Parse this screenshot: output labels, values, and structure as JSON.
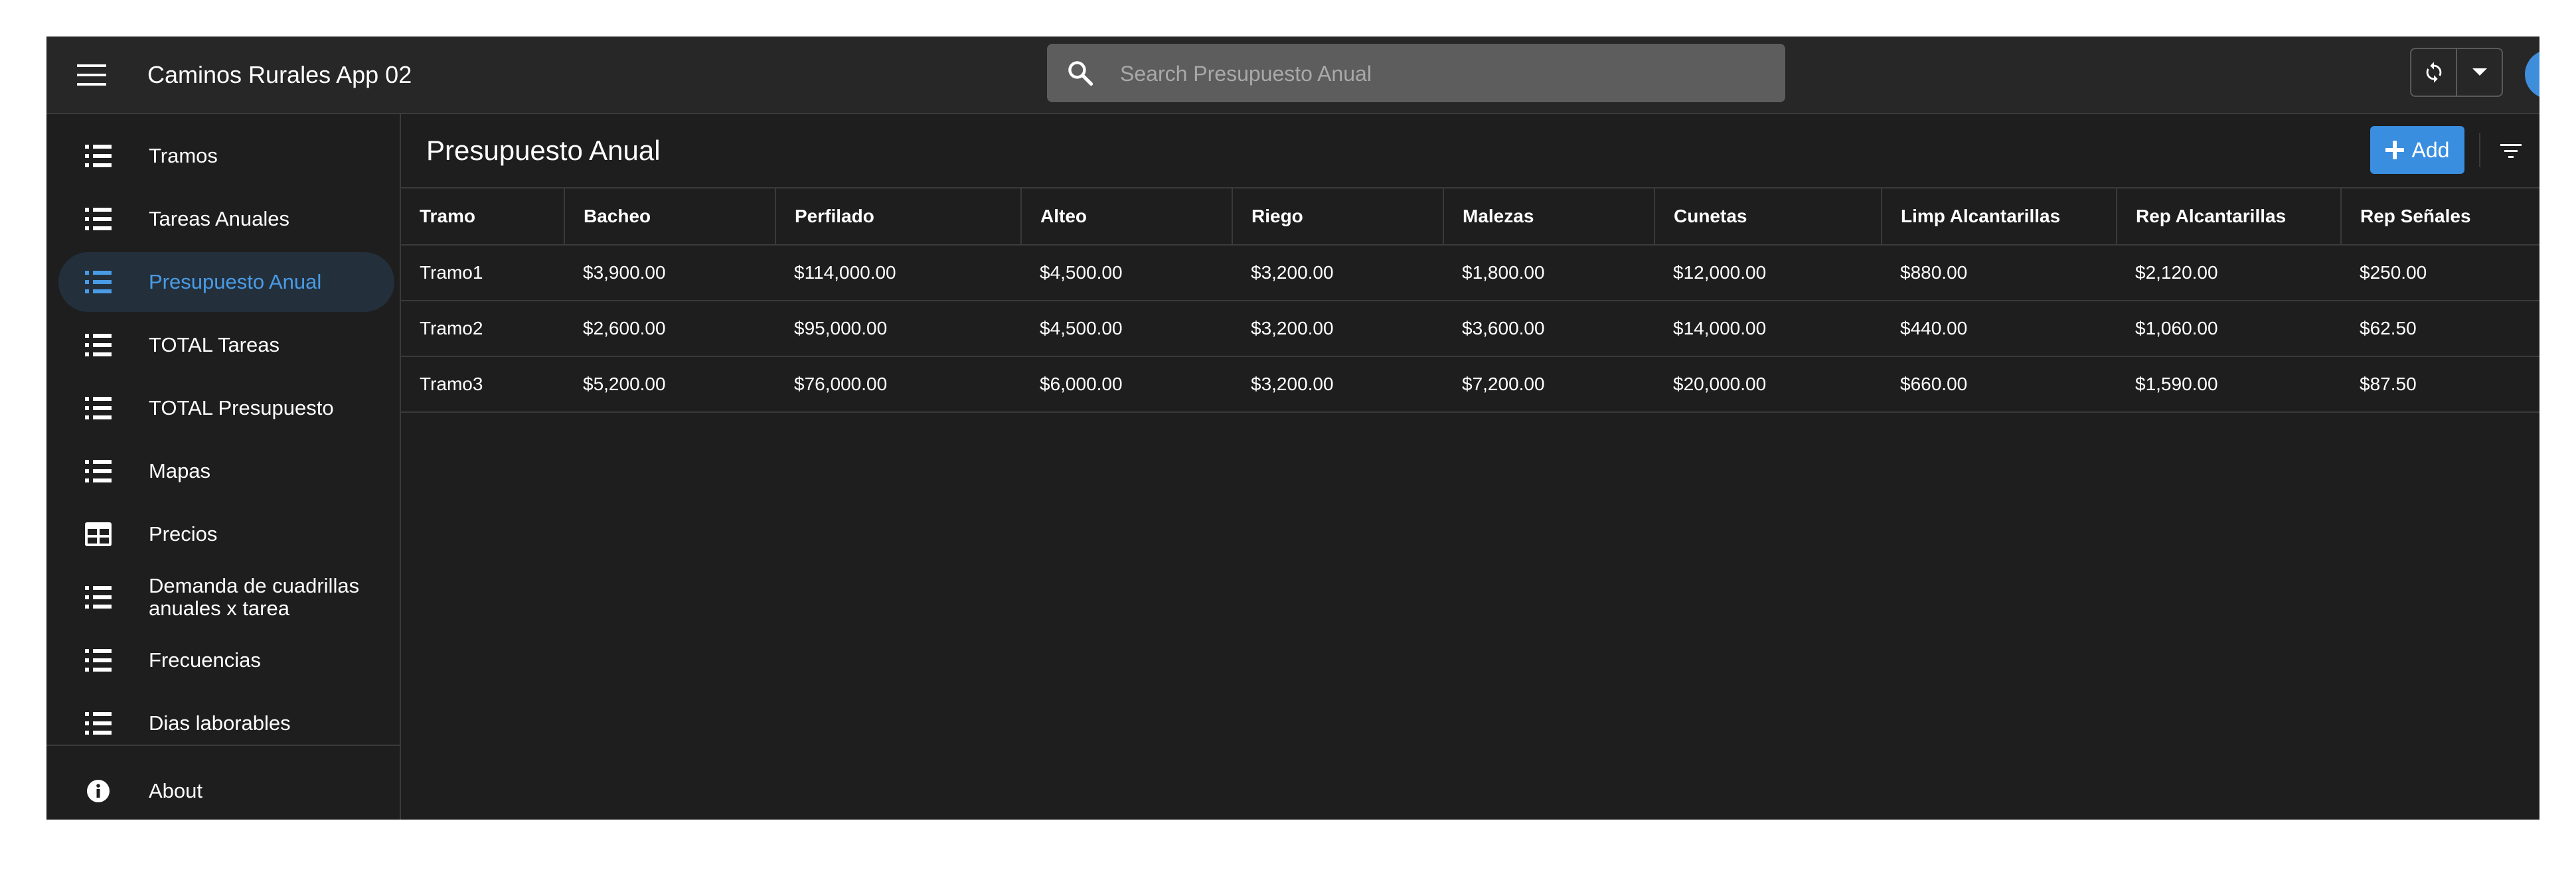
{
  "app": {
    "title": "Caminos Rurales App 02"
  },
  "search": {
    "placeholder": "Search Presupuesto Anual",
    "value": ""
  },
  "sidebar": {
    "items": [
      {
        "label": "Tramos",
        "icon": "list-icon"
      },
      {
        "label": "Tareas Anuales",
        "icon": "list-icon"
      },
      {
        "label": "Presupuesto Anual",
        "icon": "list-icon",
        "active": true
      },
      {
        "label": "TOTAL Tareas",
        "icon": "list-icon"
      },
      {
        "label": "TOTAL Presupuesto",
        "icon": "list-icon"
      },
      {
        "label": "Mapas",
        "icon": "list-icon"
      },
      {
        "label": "Precios",
        "icon": "table-icon"
      },
      {
        "label": "Demanda de cuadrillas anuales x tarea",
        "icon": "list-icon"
      },
      {
        "label": "Frecuencias",
        "icon": "list-icon"
      },
      {
        "label": "Dias laborables",
        "icon": "list-icon"
      },
      {
        "label": "About",
        "icon": "info-icon"
      }
    ]
  },
  "main": {
    "title": "Presupuesto Anual",
    "add_label": "Add",
    "table": {
      "columns": [
        "Tramo",
        "Bacheo",
        "Perfilado",
        "Alteo",
        "Riego",
        "Malezas",
        "Cunetas",
        "Limp Alcantarillas",
        "Rep Alcantarillas",
        "Rep Señales"
      ],
      "rows": [
        [
          "Tramo1",
          "$3,900.00",
          "$114,000.00",
          "$4,500.00",
          "$3,200.00",
          "$1,800.00",
          "$12,000.00",
          "$880.00",
          "$2,120.00",
          "$250.00"
        ],
        [
          "Tramo2",
          "$2,600.00",
          "$95,000.00",
          "$4,500.00",
          "$3,200.00",
          "$3,600.00",
          "$14,000.00",
          "$440.00",
          "$1,060.00",
          "$62.50"
        ],
        [
          "Tramo3",
          "$5,200.00",
          "$76,000.00",
          "$6,000.00",
          "$3,200.00",
          "$7,200.00",
          "$20,000.00",
          "$660.00",
          "$1,590.00",
          "$87.50"
        ]
      ]
    }
  },
  "colors": {
    "accent": "#3a8ee0",
    "active_text": "#4a9be6",
    "active_bg": "#23303c",
    "topbar_bg": "#272727",
    "surface_bg": "#1e1e1e",
    "search_bg": "#5d5d5d"
  }
}
